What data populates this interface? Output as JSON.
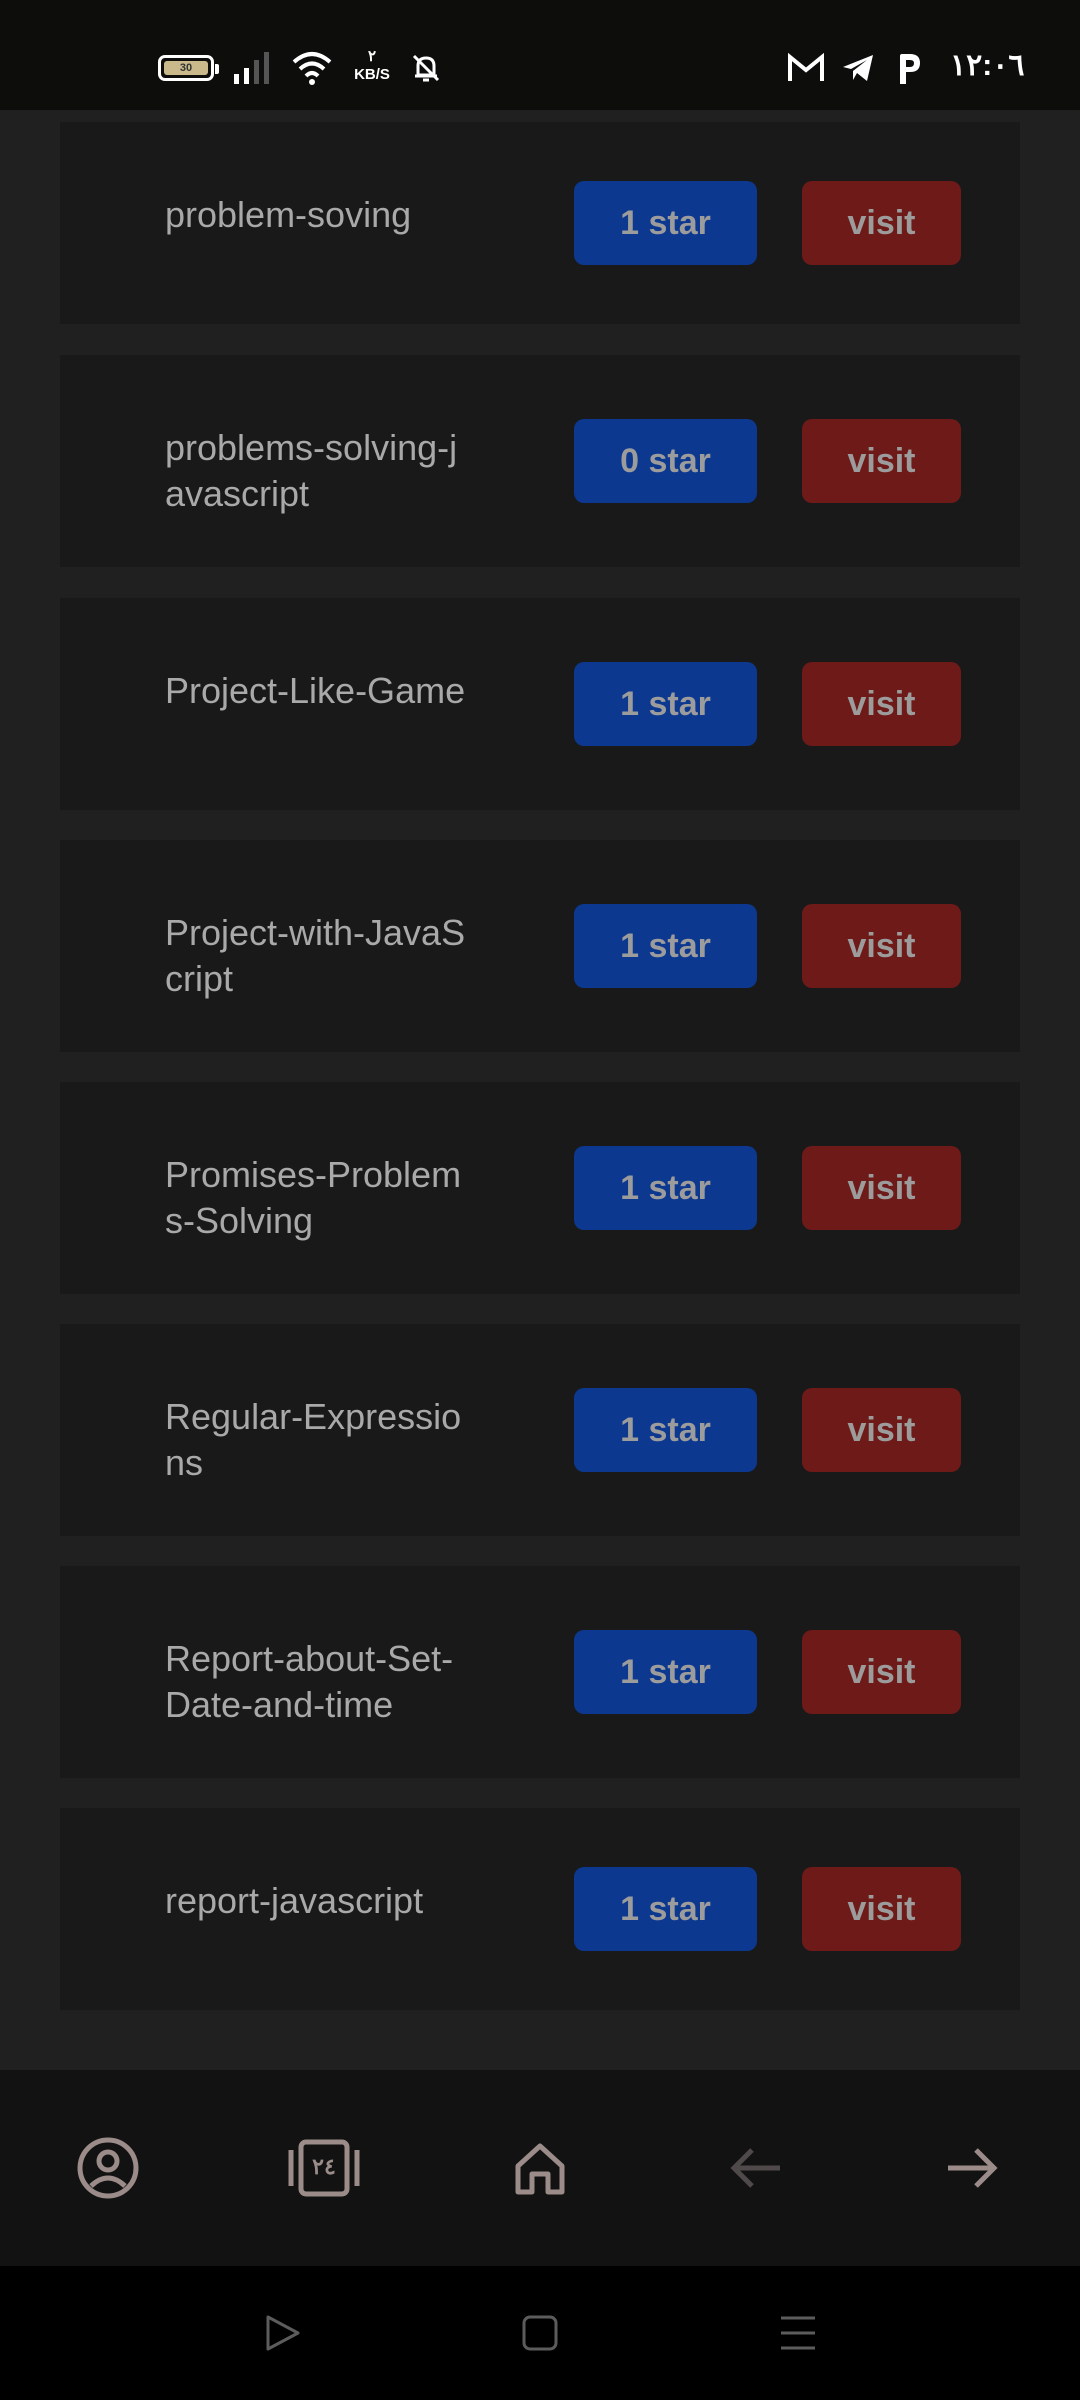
{
  "status_bar": {
    "battery_level": "30",
    "net_speed_value": "٢",
    "net_speed_unit": "KB/S",
    "time": "١٢:٠٦",
    "icons": [
      "battery-icon",
      "signal-icon",
      "wifi-icon",
      "bell-off-icon",
      "gmail-icon",
      "telegram-icon",
      "p-app-icon"
    ]
  },
  "repos": [
    {
      "name": "problem-soving",
      "stars": "1 star",
      "visit": "visit"
    },
    {
      "name": "problems-solving-javascript",
      "stars": "0 star",
      "visit": "visit"
    },
    {
      "name": "Project-Like-Game",
      "stars": "1 star",
      "visit": "visit"
    },
    {
      "name": "Project-with-JavaScript",
      "stars": "1 star",
      "visit": "visit"
    },
    {
      "name": "Promises-Problems-Solving",
      "stars": "1 star",
      "visit": "visit"
    },
    {
      "name": "Regular-Expressions",
      "stars": "1 star",
      "visit": "visit"
    },
    {
      "name": "Report-about-Set-Date-and-time",
      "stars": "1 star",
      "visit": "visit"
    },
    {
      "name": "report-javascript",
      "stars": "1 star",
      "visit": "visit"
    }
  ],
  "bottom_nav": {
    "tabs_count": "٢٤",
    "icons": [
      "profile-icon",
      "tabs-icon",
      "home-icon",
      "back-arrow-icon",
      "forward-arrow-icon"
    ]
  },
  "system_nav": {
    "icons": [
      "play-icon",
      "recents-square-icon",
      "menu-icon"
    ]
  },
  "colors": {
    "page_bg": "#202020",
    "card_bg": "#191919",
    "star_button": "#0d3890",
    "visit_button": "#6e1a18",
    "text": "#a9a9a9"
  }
}
